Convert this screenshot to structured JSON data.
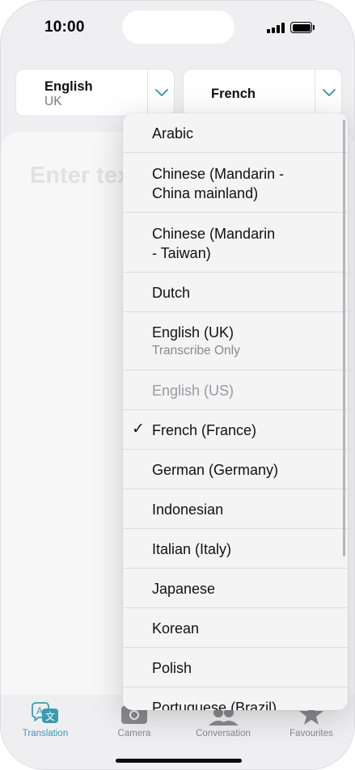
{
  "status": {
    "time": "10:00"
  },
  "source_language": {
    "name": "English",
    "region": "UK"
  },
  "target_language": {
    "name": "French"
  },
  "input": {
    "placeholder": "Enter text"
  },
  "menu": {
    "items": [
      {
        "label": "Arabic"
      },
      {
        "label": "Chinese (Mandarin -",
        "label2": "China mainland)"
      },
      {
        "label": "Chinese (Mandarin",
        "label2": "- Taiwan)"
      },
      {
        "label": "Dutch"
      },
      {
        "label": "English (UK)",
        "sub": "Transcribe Only"
      },
      {
        "label": "English (US)",
        "disabled": true
      },
      {
        "label": "French (France)",
        "checked": true,
        "checkmark": "✓"
      },
      {
        "label": "German (Germany)"
      },
      {
        "label": "Indonesian"
      },
      {
        "label": "Italian (Italy)"
      },
      {
        "label": "Japanese"
      },
      {
        "label": "Korean"
      },
      {
        "label": "Polish"
      },
      {
        "label": "Portuguese (Brazil)"
      }
    ]
  },
  "tabs": [
    {
      "label": "Translation",
      "icon": "translate-icon",
      "active": true
    },
    {
      "label": "Camera",
      "icon": "camera-icon"
    },
    {
      "label": "Conversation",
      "icon": "conversation-icon"
    },
    {
      "label": "Favourites",
      "icon": "star-icon"
    }
  ],
  "colors": {
    "accent": "#3a9bb0",
    "chevron": "#3a8fa6"
  }
}
